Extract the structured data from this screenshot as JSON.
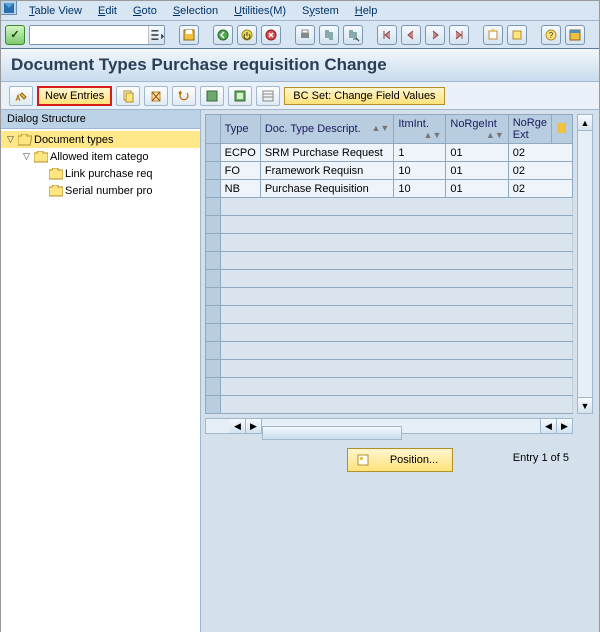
{
  "menu": {
    "items": [
      {
        "label": "Table View",
        "accel": "T"
      },
      {
        "label": "Edit",
        "accel": "E"
      },
      {
        "label": "Goto",
        "accel": "G"
      },
      {
        "label": "Selection",
        "accel": "S"
      },
      {
        "label": "Utilities(M)",
        "accel": "U"
      },
      {
        "label": "System",
        "accel": "S"
      },
      {
        "label": "Help",
        "accel": "H"
      }
    ]
  },
  "page": {
    "title": "Document Types Purchase requisition Change"
  },
  "app_toolbar": {
    "new_entries_label": "New Entries",
    "bcset_label": "BC Set: Change Field Values"
  },
  "dialog_structure": {
    "header": "Dialog Structure",
    "nodes": [
      {
        "label": "Document types",
        "level": 0,
        "expanded": true,
        "selected": true
      },
      {
        "label": "Allowed item catego",
        "level": 1,
        "expanded": true,
        "selected": false
      },
      {
        "label": "Link purchase req",
        "level": 2,
        "expanded": false,
        "selected": false
      },
      {
        "label": "Serial number pro",
        "level": 2,
        "expanded": false,
        "selected": false
      }
    ]
  },
  "grid": {
    "columns": [
      "Type",
      "Doc. Type Descript.",
      "ItmInt.",
      "NoRgeInt",
      "NoRge Ext"
    ],
    "rows": [
      {
        "type": "ECPO",
        "desc": "SRM Purchase Request",
        "itm": "1",
        "int": "01",
        "ext": "02"
      },
      {
        "type": "FO",
        "desc": "Framework Requisn",
        "itm": "10",
        "int": "01",
        "ext": "02"
      },
      {
        "type": "NB",
        "desc": "Purchase Requisition",
        "itm": "10",
        "int": "01",
        "ext": "02"
      }
    ]
  },
  "footer": {
    "position_label": "Position...",
    "entry_count": "Entry 1 of 5"
  },
  "chart_data": {
    "type": "table",
    "title": "Document Types Purchase requisition Change",
    "columns": [
      "Type",
      "Doc. Type Descript.",
      "ItmInt.",
      "NoRgeInt",
      "NoRge Ext"
    ],
    "rows": [
      [
        "ECPO",
        "SRM Purchase Request",
        "1",
        "01",
        "02"
      ],
      [
        "FO",
        "Framework Requisn",
        "10",
        "01",
        "02"
      ],
      [
        "NB",
        "Purchase Requisition",
        "10",
        "01",
        "02"
      ]
    ]
  }
}
